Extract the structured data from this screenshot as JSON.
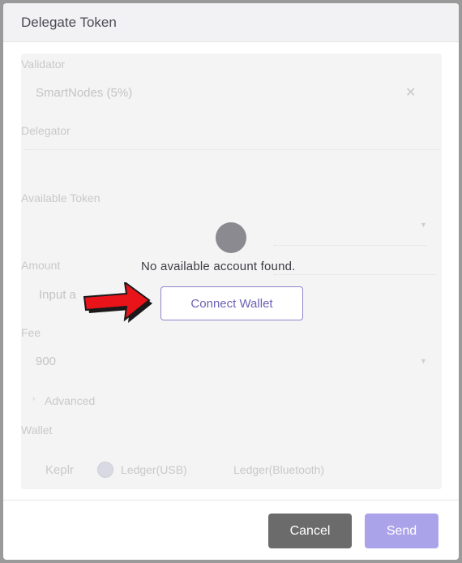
{
  "dialog": {
    "title": "Delegate Token",
    "form": {
      "validator_label": "Validator",
      "validator_value": "SmartNodes (5%)",
      "delegator_label": "Delegator",
      "available_token_label": "Available Token",
      "amount_label": "Amount",
      "amount_placeholder": "Input a",
      "fee_label": "Fee",
      "fee_value": "900",
      "advanced_label": "Advanced",
      "wallet_label": "Wallet",
      "wallet_options": [
        "Keplr",
        "Ledger(USB)",
        "Ledger(Bluetooth)"
      ]
    },
    "overlay": {
      "message": "No available account found.",
      "connect_button": "Connect Wallet"
    },
    "footer": {
      "cancel": "Cancel",
      "send": "Send"
    }
  },
  "colors": {
    "accent": "#6c62b5",
    "send_button": "#aba3ea",
    "cancel_button": "#6b6b6b",
    "arrow": "#e8141a"
  }
}
